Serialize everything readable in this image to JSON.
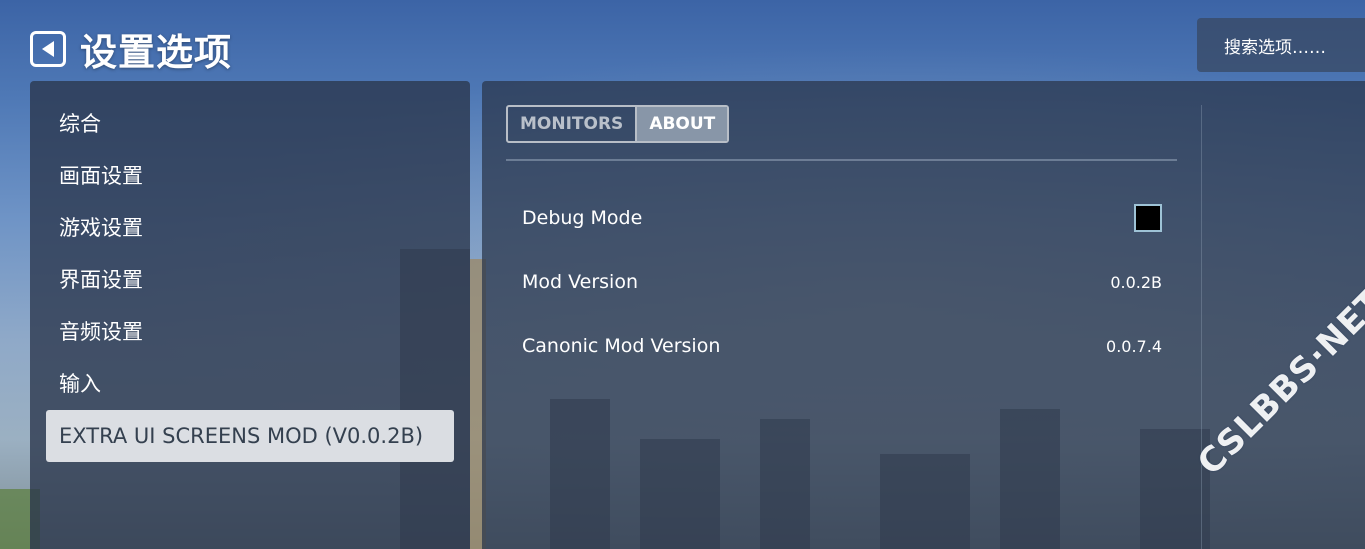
{
  "header": {
    "title": "设置选项",
    "back_icon": "back-arrow-icon",
    "search_label": "搜索选项……"
  },
  "sidebar": {
    "items": [
      {
        "label": "综合",
        "active": false
      },
      {
        "label": "画面设置",
        "active": false
      },
      {
        "label": "游戏设置",
        "active": false
      },
      {
        "label": "界面设置",
        "active": false
      },
      {
        "label": "音频设置",
        "active": false
      },
      {
        "label": "输入",
        "active": false
      },
      {
        "label": "EXTRA UI SCREENS MOD (V0.0.2B)",
        "active": true
      }
    ]
  },
  "main": {
    "tabs": [
      {
        "label": "MONITORS",
        "active": false
      },
      {
        "label": "ABOUT",
        "active": true
      }
    ],
    "rows": [
      {
        "label": "Debug Mode",
        "type": "checkbox",
        "checked": false
      },
      {
        "label": "Mod Version",
        "type": "value",
        "value": "0.0.2B"
      },
      {
        "label": "Canonic Mod Version",
        "type": "value",
        "value": "0.0.7.4"
      }
    ]
  },
  "watermark": "CSLBBS·NET",
  "colors": {
    "panel_bg": "#2a364c",
    "active_item_bg": "#e8eaee",
    "active_tab_bg": "#8896a8",
    "checkbox_border": "#9ec3d6"
  }
}
